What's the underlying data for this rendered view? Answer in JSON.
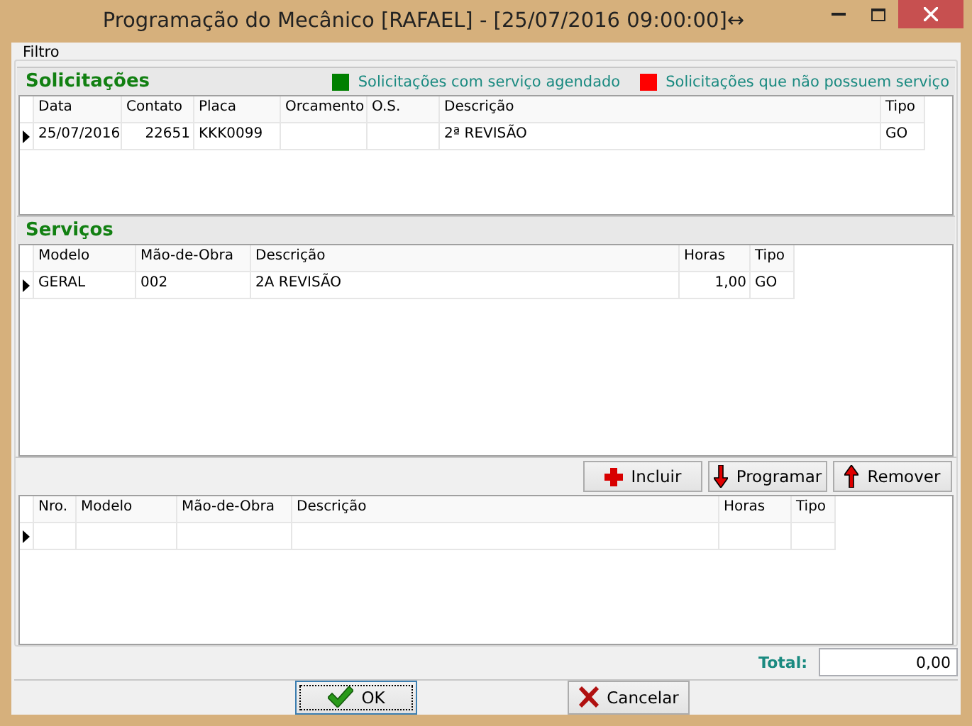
{
  "window": {
    "title": "Programação do Mecânico [RAFAEL] - [25/07/2016 09:00:00]",
    "resize_glyph": "↔"
  },
  "filter_group": {
    "label": "Filtro"
  },
  "solicitacoes": {
    "title": "Solicitações",
    "legend": [
      {
        "label": "Solicitações com serviço agendado",
        "color": "#008000"
      },
      {
        "label": "Solicitações que não possuem serviço",
        "color": "#ff0000"
      }
    ],
    "columns": [
      "Data",
      "Contato",
      "Placa",
      "Orcamento",
      "O.S.",
      "Descrição",
      "Tipo"
    ],
    "rows": [
      {
        "current": true,
        "cells": [
          "25/07/2016",
          "22651",
          "KKK0099",
          "",
          "",
          "2ª REVISÃO",
          "GO"
        ]
      }
    ]
  },
  "servicos": {
    "title": "Serviços",
    "columns": [
      "Modelo",
      "Mão-de-Obra",
      "Descrição",
      "Horas",
      "Tipo"
    ],
    "rows": [
      {
        "current": true,
        "cells": [
          "GERAL",
          "002",
          "2A REVISÃO",
          "1,00",
          "GO"
        ]
      }
    ]
  },
  "actions": [
    {
      "label": "Incluir",
      "kind": "add"
    },
    {
      "label": "Programar",
      "kind": "down"
    },
    {
      "label": "Remover",
      "kind": "up"
    }
  ],
  "programados": {
    "columns": [
      "Nro.",
      "Modelo",
      "Mão-de-Obra",
      "Descrição",
      "Horas",
      "Tipo"
    ],
    "rows": [
      {
        "current": true
      }
    ]
  },
  "total": {
    "label": "Total:",
    "value": "0,00"
  },
  "buttons": [
    {
      "label": "OK",
      "kind": "ok",
      "focused": true
    },
    {
      "label": "Cancelar",
      "kind": "cancel",
      "focused": false
    }
  ]
}
